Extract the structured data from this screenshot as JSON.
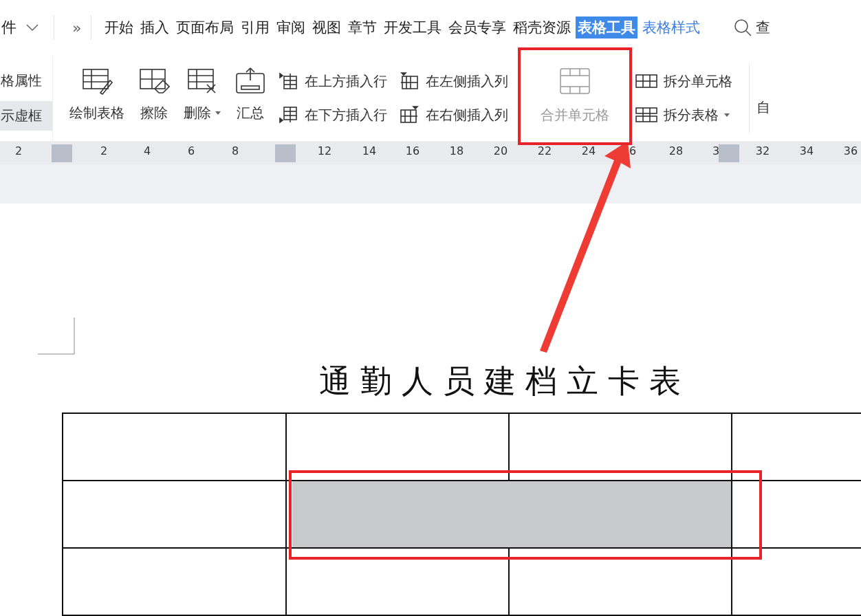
{
  "menu": {
    "file_label": "件",
    "more": "»"
  },
  "tabs": [
    {
      "label": "开始",
      "selected": false
    },
    {
      "label": "插入",
      "selected": false
    },
    {
      "label": "页面布局",
      "selected": false
    },
    {
      "label": "引用",
      "selected": false
    },
    {
      "label": "审阅",
      "selected": false
    },
    {
      "label": "视图",
      "selected": false
    },
    {
      "label": "章节",
      "selected": false
    },
    {
      "label": "开发工具",
      "selected": false
    },
    {
      "label": "会员专享",
      "selected": false
    },
    {
      "label": "稻壳资源",
      "selected": false
    },
    {
      "label": "表格工具",
      "selected": true
    },
    {
      "label": "表格样式",
      "selected": false,
      "kind": "context"
    }
  ],
  "search": {
    "label": "查"
  },
  "ribbon": {
    "left_items": [
      {
        "label": "格属性",
        "selected": false
      },
      {
        "label": "示虚框",
        "selected": true
      }
    ],
    "big_buttons": [
      {
        "label": "绘制表格",
        "kind": "draw"
      },
      {
        "label": "擦除",
        "kind": "erase"
      },
      {
        "label": "删除",
        "kind": "delete",
        "dropdown": true
      },
      {
        "label": "汇总",
        "kind": "sum"
      }
    ],
    "insert_rows": [
      {
        "label": "在上方插入行",
        "kind": "above"
      },
      {
        "label": "在下方插入行",
        "kind": "below"
      }
    ],
    "insert_cols": [
      {
        "label": "在左侧插入列",
        "kind": "left"
      },
      {
        "label": "在右侧插入列",
        "kind": "right"
      }
    ],
    "merge": {
      "label": "合并单元格",
      "disabled": true,
      "callout": true
    },
    "split": [
      {
        "label": "拆分单元格",
        "kind": "cells",
        "dropdown": false
      },
      {
        "label": "拆分表格",
        "kind": "table",
        "dropdown": true
      }
    ],
    "right_label": "自"
  },
  "ruler": [
    "2",
    "2",
    "4",
    "6",
    "8",
    "12",
    "14",
    "16",
    "18",
    "20",
    "22",
    "24",
    "6",
    "28",
    "3",
    "32",
    "34",
    "36"
  ],
  "document": {
    "title": "通勤人员建档立卡表",
    "table": {
      "rows": [
        {
          "cells": [
            {
              "merged": false,
              "selected": false
            },
            {
              "merged": false,
              "selected": false
            },
            {
              "merged": false,
              "selected": false
            },
            {
              "merged": false,
              "selected": false
            }
          ]
        },
        {
          "cells": [
            {
              "merged": false,
              "selected": false
            },
            {
              "merged": true,
              "selected": true,
              "callout": true
            },
            {
              "merged": false,
              "selected": false
            }
          ]
        },
        {
          "cells": [
            {
              "merged": false,
              "selected": false
            },
            {
              "merged": false,
              "selected": false
            },
            {
              "merged": false,
              "selected": false
            },
            {
              "merged": false,
              "selected": false
            }
          ]
        }
      ]
    }
  }
}
